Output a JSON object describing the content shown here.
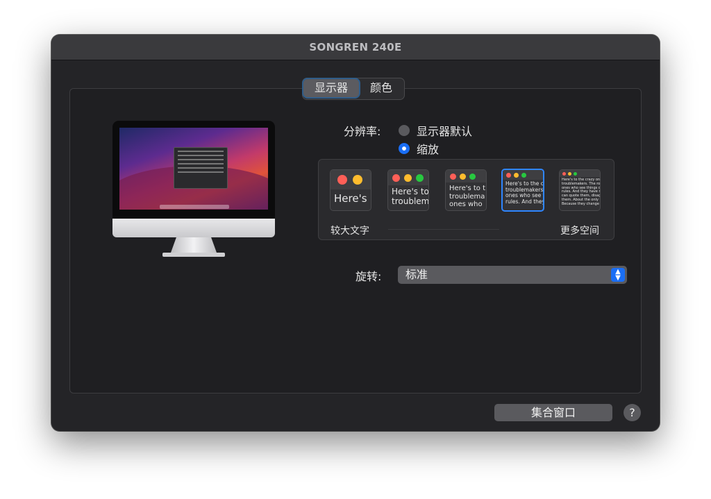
{
  "window": {
    "title": "SONGREN 240E"
  },
  "tabs": [
    {
      "label": "显示器",
      "active": true
    },
    {
      "label": "颜色",
      "active": false
    }
  ],
  "resolution": {
    "label": "分辨率:",
    "options": [
      {
        "label": "显示器默认",
        "selected": false
      },
      {
        "label": "缩放",
        "selected": true
      }
    ]
  },
  "scale": {
    "thumbnails": [
      {
        "text": "Here's"
      },
      {
        "text": "Here's to\ntroublem"
      },
      {
        "text": "Here's to t\ntroublema\nones who"
      },
      {
        "text": "Here's to the cr\ntroublemakers.\nones who see t\nrules. And they"
      },
      {
        "text": "Here's to the crazy one\ntroublemakers. The rou\nones who see things dif\nrules. And they have no\ncan quote them, disagre\nthem. About the only th\nBecause they change th"
      }
    ],
    "selected_index": 3,
    "left_label": "较大文字",
    "right_label": "更多空间"
  },
  "rotation": {
    "label": "旋转:",
    "value": "标准"
  },
  "buttons": {
    "gather_windows": "集合窗口",
    "help": "?"
  },
  "colors": {
    "accent": "#1a6ef5",
    "window_bg": "#242427",
    "red": "#ff5f57",
    "yellow": "#febc2e",
    "green": "#28c840"
  }
}
